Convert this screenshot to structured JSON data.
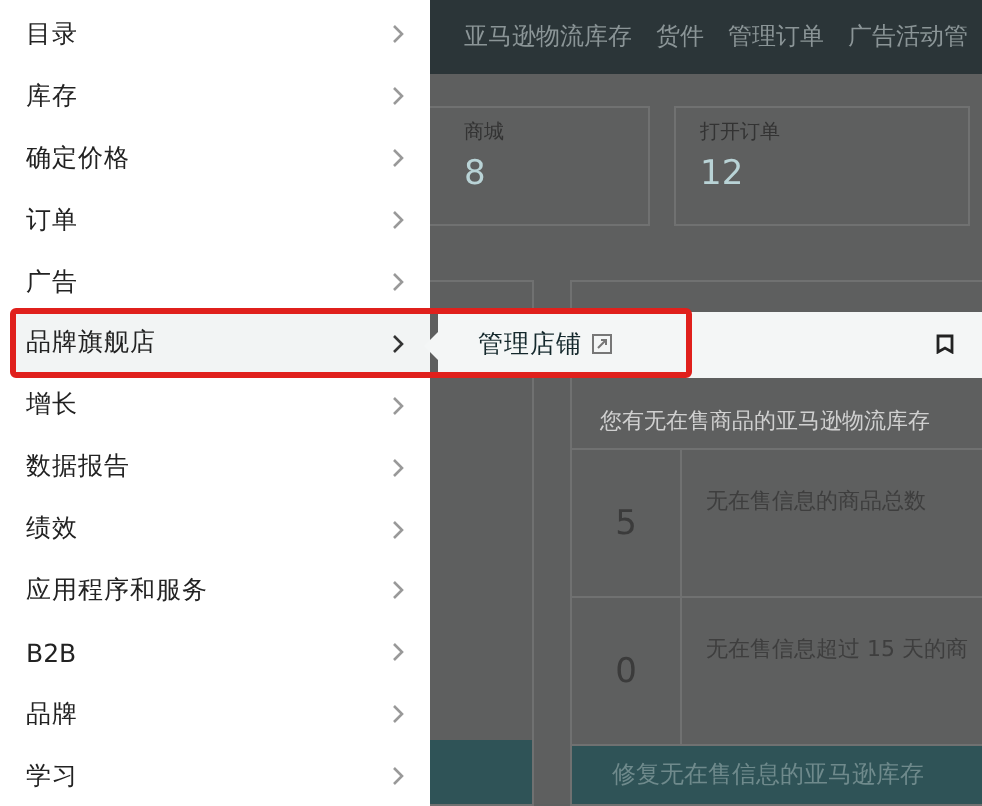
{
  "sidebar": {
    "items": [
      {
        "label": "目录",
        "selected": false
      },
      {
        "label": "库存",
        "selected": false
      },
      {
        "label": "确定价格",
        "selected": false
      },
      {
        "label": "订单",
        "selected": false
      },
      {
        "label": "广告",
        "selected": false
      },
      {
        "label": "品牌旗舰店",
        "selected": true
      },
      {
        "label": "增长",
        "selected": false
      },
      {
        "label": "数据报告",
        "selected": false
      },
      {
        "label": "绩效",
        "selected": false
      },
      {
        "label": "应用程序和服务",
        "selected": false
      },
      {
        "label": "B2B",
        "selected": false
      },
      {
        "label": "品牌",
        "selected": false
      },
      {
        "label": "学习",
        "selected": false
      }
    ]
  },
  "flyout": {
    "items": [
      {
        "label": "管理店铺"
      }
    ]
  },
  "top_nav": {
    "items": [
      "亚马逊物流库存",
      "货件",
      "管理订单",
      "广告活动管"
    ]
  },
  "stat_cards": [
    {
      "label": "商城",
      "value": "8"
    },
    {
      "label": "打开订单",
      "value": "12"
    }
  ],
  "panel": {
    "subtitle": "您有无在售商品的亚马逊物流库存",
    "rows": [
      {
        "value": "5",
        "label": "无在售信息的商品总数"
      },
      {
        "value": "0",
        "label": "无在售信息超过 15 天的商"
      }
    ],
    "button": "修复无在售信息的亚马逊库存"
  }
}
